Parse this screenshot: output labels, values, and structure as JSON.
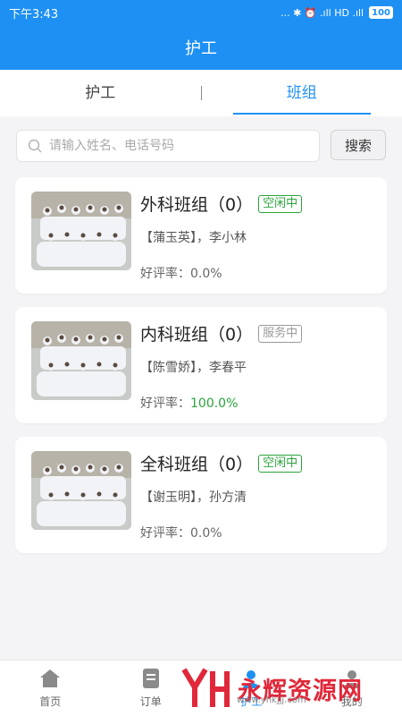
{
  "status_bar": {
    "time": "下午3:43",
    "indicators": "... ✱ ⏰ .ıll HD .ıll",
    "battery": "100"
  },
  "header": {
    "title": "护工"
  },
  "tabs": [
    {
      "label": "护工",
      "active": false
    },
    {
      "label": "班组",
      "active": true
    }
  ],
  "search": {
    "placeholder": "请输入姓名、电话号码",
    "value": "",
    "button_label": "搜索"
  },
  "teams": [
    {
      "name": "外科班组（0）",
      "status": "空闲中",
      "status_color": "#2ba33c",
      "members_highlight": "【蒲玉英】",
      "members_rest": "，李小林",
      "rating_label": "好评率：",
      "rating_value": "0.0%",
      "rating_color": "#666666"
    },
    {
      "name": "内科班组（0）",
      "status": "服务中",
      "status_color": "#9a9a9a",
      "members_highlight": "【陈雪娇】",
      "members_rest": "，李春平",
      "rating_label": "好评率：",
      "rating_value": "100.0%",
      "rating_color": "#2ba33c"
    },
    {
      "name": "全科班组（0）",
      "status": "空闲中",
      "status_color": "#2ba33c",
      "members_highlight": "【谢玉明】",
      "members_rest": "，孙方清",
      "rating_label": "好评率：",
      "rating_value": "0.0%",
      "rating_color": "#666666"
    }
  ],
  "bottom_nav": [
    {
      "label": "首页",
      "icon": "home-icon"
    },
    {
      "label": "订单",
      "icon": "order-icon"
    },
    {
      "label": "护工",
      "icon": "caregiver-icon",
      "active": true
    },
    {
      "label": "我的",
      "icon": "profile-icon"
    }
  ],
  "watermark": {
    "text": "永辉资源网",
    "url": "www.yhkjjj.com"
  },
  "colors": {
    "primary": "#1e90f3",
    "success": "#2ba33c",
    "brand_red": "#e0283a"
  }
}
